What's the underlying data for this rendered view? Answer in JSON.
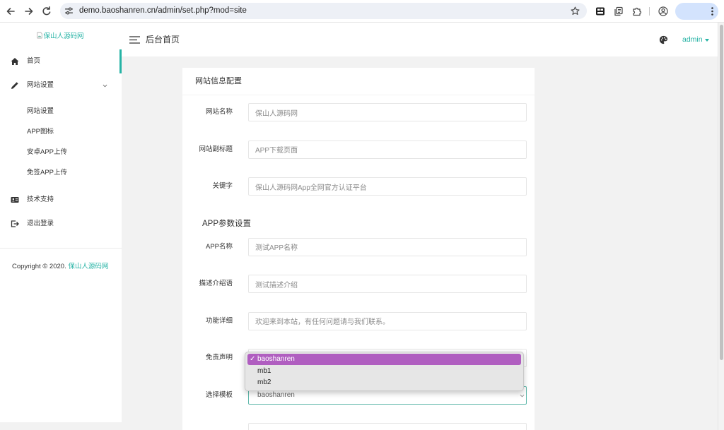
{
  "browser": {
    "url": "demo.baoshanren.cn/admin/set.php?mod=site"
  },
  "sidebar": {
    "logo_alt": "保山人源码网",
    "menu": [
      {
        "label": "首页",
        "icon": "home-icon"
      },
      {
        "label": "网站设置",
        "icon": "pencil-icon"
      },
      {
        "label": "技术支持",
        "icon": "id-card-icon"
      },
      {
        "label": "退出登录",
        "icon": "sign-out-icon"
      }
    ],
    "submenu": [
      {
        "label": "网站设置"
      },
      {
        "label": "APP图标"
      },
      {
        "label": "安卓APP上传"
      },
      {
        "label": "免签APP上传"
      }
    ],
    "copyright": "Copyright © 2020. ",
    "copyright_link": "保山人源码网"
  },
  "header": {
    "title": "后台首页",
    "user": "admin"
  },
  "card": {
    "title": "网站信息配置",
    "site_fields": [
      {
        "label": "网站名称",
        "value": "保山人源码网"
      },
      {
        "label": "网站副标题",
        "value": "APP下载页面"
      },
      {
        "label": "关键字",
        "value": "保山人源码网App全网官方认证平台"
      }
    ],
    "app_section_title": "APP参数设置",
    "app_fields": [
      {
        "label": "APP名称",
        "value": "测试APP名称"
      },
      {
        "label": "描述介绍语",
        "value": "测试描述介绍"
      },
      {
        "label": "功能详细",
        "value": "欢迎来到本站，有任何问题请与我们联系。"
      },
      {
        "label": "免责声明"
      }
    ],
    "template_select": {
      "label": "选择模板",
      "value": "baoshanren"
    }
  },
  "dropdown": {
    "checkmark": "✓",
    "options": [
      "baoshanren",
      "mb1",
      "mb2"
    ],
    "selected_index": 0
  },
  "colors": {
    "accent": "#26b3a5",
    "highlight": "#b05ec0"
  }
}
